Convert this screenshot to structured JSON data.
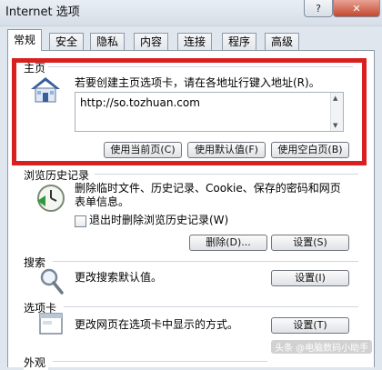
{
  "window": {
    "title": "Internet 选项",
    "help_label": "?",
    "close_label": "✕"
  },
  "tabs": [
    {
      "label": "常规",
      "active": true
    },
    {
      "label": "安全"
    },
    {
      "label": "隐私"
    },
    {
      "label": "内容"
    },
    {
      "label": "连接"
    },
    {
      "label": "程序"
    },
    {
      "label": "高级"
    }
  ],
  "homepage": {
    "group_label": "主页",
    "icon": "house-icon",
    "description": "若要创建主页选项卡，请在各地址行键入地址(R)。",
    "url": "http://so.tozhuan.com",
    "buttons": {
      "use_current": "使用当前页(C)",
      "use_default": "使用默认值(F)",
      "use_blank": "使用空白页(B)"
    }
  },
  "history": {
    "group_label": "浏览历史记录",
    "icon": "history-clock-icon",
    "description_line1": "删除临时文件、历史记录、Cookie、保存的密码和网页",
    "description_line2": "表单信息。",
    "checkbox_label": "退出时删除浏览历史记录(W)",
    "delete_button": "删除(D)...",
    "settings_button": "设置(S)"
  },
  "search": {
    "group_label": "搜索",
    "icon": "magnifier-icon",
    "description": "更改搜索默认值。",
    "settings_button": "设置(I)"
  },
  "tabs_section": {
    "group_label": "选项卡",
    "icon": "tab-window-icon",
    "description": "更改网页在选项卡中显示的方式。",
    "settings_button": "设置(T)"
  },
  "appearance": {
    "group_label": "外观"
  },
  "watermark": "头条 @电脑数码小助手",
  "colors": {
    "highlight": "#d92020"
  }
}
